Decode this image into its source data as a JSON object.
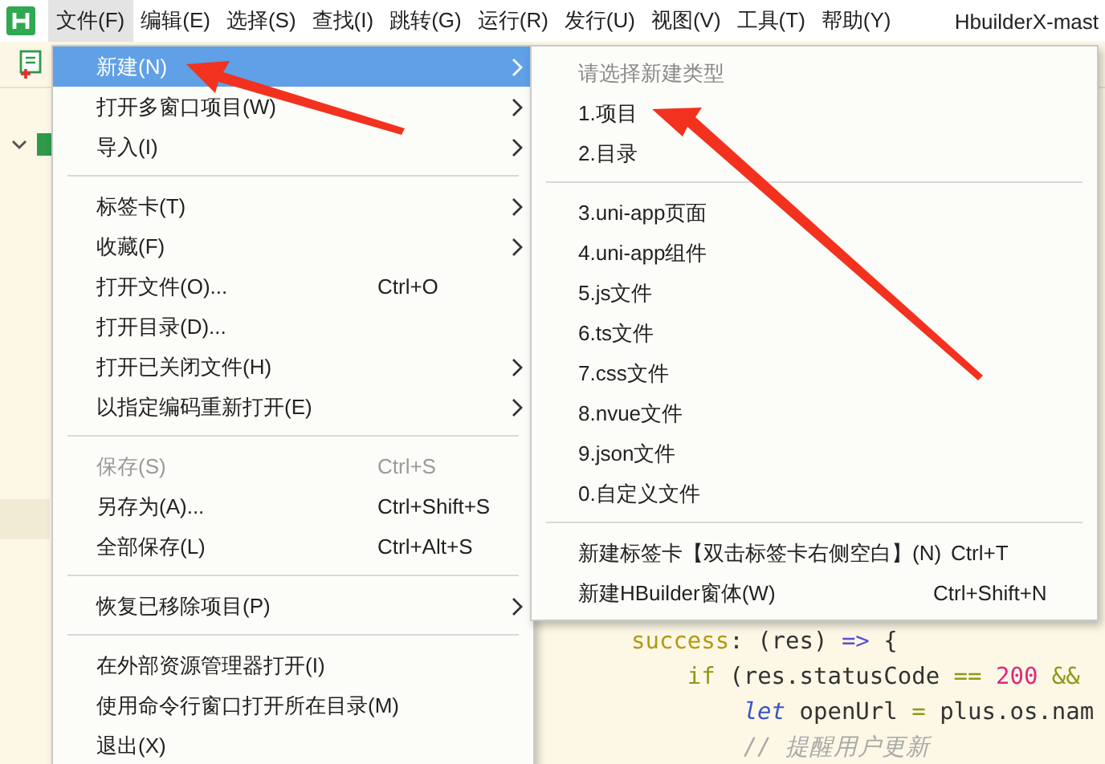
{
  "menu_bar": [
    {
      "label": "文件(F)",
      "selected": true
    },
    {
      "label": "编辑(E)",
      "selected": false
    },
    {
      "label": "选择(S)",
      "selected": false
    },
    {
      "label": "查找(I)",
      "selected": false
    },
    {
      "label": "跳转(G)",
      "selected": false
    },
    {
      "label": "运行(R)",
      "selected": false
    },
    {
      "label": "发行(U)",
      "selected": false
    },
    {
      "label": "视图(V)",
      "selected": false
    },
    {
      "label": "工具(T)",
      "selected": false
    },
    {
      "label": "帮助(Y)",
      "selected": false
    }
  ],
  "window_title": "HbuilderX-mast",
  "project_tree": {
    "expanded": true
  },
  "file_menu": {
    "items": [
      {
        "kind": "item",
        "label": "新建(N)",
        "submenu": true,
        "selected": true,
        "disabled": false
      },
      {
        "kind": "item",
        "label": "打开多窗口项目(W)",
        "submenu": true,
        "selected": false,
        "disabled": false
      },
      {
        "kind": "item",
        "label": "导入(I)",
        "submenu": true,
        "selected": false,
        "disabled": false
      },
      {
        "kind": "separator"
      },
      {
        "kind": "item",
        "label": "标签卡(T)",
        "submenu": true,
        "selected": false,
        "disabled": false
      },
      {
        "kind": "item",
        "label": "收藏(F)",
        "submenu": true,
        "selected": false,
        "disabled": false
      },
      {
        "kind": "item",
        "label": "打开文件(O)...",
        "shortcut": "Ctrl+O",
        "submenu": false,
        "selected": false,
        "disabled": false
      },
      {
        "kind": "item",
        "label": "打开目录(D)...",
        "submenu": false,
        "selected": false,
        "disabled": false
      },
      {
        "kind": "item",
        "label": "打开已关闭文件(H)",
        "submenu": true,
        "selected": false,
        "disabled": false
      },
      {
        "kind": "item",
        "label": "以指定编码重新打开(E)",
        "submenu": true,
        "selected": false,
        "disabled": false
      },
      {
        "kind": "separator"
      },
      {
        "kind": "item",
        "label": "保存(S)",
        "shortcut": "Ctrl+S",
        "submenu": false,
        "selected": false,
        "disabled": true
      },
      {
        "kind": "item",
        "label": "另存为(A)...",
        "shortcut": "Ctrl+Shift+S",
        "submenu": false,
        "selected": false,
        "disabled": false
      },
      {
        "kind": "item",
        "label": "全部保存(L)",
        "shortcut": "Ctrl+Alt+S",
        "submenu": false,
        "selected": false,
        "disabled": false
      },
      {
        "kind": "separator"
      },
      {
        "kind": "item",
        "label": "恢复已移除项目(P)",
        "submenu": true,
        "selected": false,
        "disabled": false
      },
      {
        "kind": "separator"
      },
      {
        "kind": "item",
        "label": "在外部资源管理器打开(I)",
        "submenu": false,
        "selected": false,
        "disabled": false
      },
      {
        "kind": "item",
        "label": "使用命令行窗口打开所在目录(M)",
        "submenu": false,
        "selected": false,
        "disabled": false
      },
      {
        "kind": "item",
        "label": "退出(X)",
        "submenu": false,
        "selected": false,
        "disabled": false
      }
    ]
  },
  "new_submenu": {
    "items": [
      {
        "kind": "header",
        "label": "请选择新建类型"
      },
      {
        "kind": "item",
        "label": "1.项目",
        "submenu": false,
        "selected": false,
        "disabled": false
      },
      {
        "kind": "item",
        "label": "2.目录",
        "submenu": false,
        "selected": false,
        "disabled": false
      },
      {
        "kind": "separator"
      },
      {
        "kind": "item",
        "label": "3.uni-app页面",
        "submenu": false,
        "selected": false,
        "disabled": false
      },
      {
        "kind": "item",
        "label": "4.uni-app组件",
        "submenu": false,
        "selected": false,
        "disabled": false
      },
      {
        "kind": "item",
        "label": "5.js文件",
        "submenu": false,
        "selected": false,
        "disabled": false
      },
      {
        "kind": "item",
        "label": "6.ts文件",
        "submenu": false,
        "selected": false,
        "disabled": false
      },
      {
        "kind": "item",
        "label": "7.css文件",
        "submenu": false,
        "selected": false,
        "disabled": false
      },
      {
        "kind": "item",
        "label": "8.nvue文件",
        "submenu": false,
        "selected": false,
        "disabled": false
      },
      {
        "kind": "item",
        "label": "9.json文件",
        "submenu": false,
        "selected": false,
        "disabled": false
      },
      {
        "kind": "item",
        "label": "0.自定义文件",
        "submenu": false,
        "selected": false,
        "disabled": false
      },
      {
        "kind": "separator"
      },
      {
        "kind": "item",
        "label": "新建标签卡【双击标签卡右侧空白】(N)",
        "shortcut": "Ctrl+T",
        "submenu": false,
        "selected": false,
        "disabled": false
      },
      {
        "kind": "item",
        "label": "新建HBuilder窗体(W)",
        "shortcut": "Ctrl+Shift+N",
        "submenu": false,
        "selected": false,
        "disabled": false
      }
    ]
  },
  "code_lines": [
    {
      "tokens": [
        {
          "kind": "property",
          "text": "success"
        },
        {
          "kind": "plain",
          "text": ": (res) "
        },
        {
          "kind": "operator",
          "text": "=>"
        },
        {
          "kind": "plain",
          "text": " {"
        }
      ],
      "children": [
        {
          "tokens": [
            {
              "kind": "control",
              "text": "if"
            },
            {
              "kind": "plain",
              "text": " (res.statusCode "
            },
            {
              "kind": "control",
              "text": "== "
            },
            {
              "kind": "number",
              "text": "200 "
            },
            {
              "kind": "control",
              "text": "&&"
            }
          ],
          "children": [
            {
              "tokens": [
                {
                  "kind": "keyword",
                  "text": "let"
                },
                {
                  "kind": "plain",
                  "text": " openUrl "
                },
                {
                  "kind": "control",
                  "text": "="
                },
                {
                  "kind": "plain",
                  "text": " plus.os.nam"
                }
              ]
            },
            {
              "tokens": [
                {
                  "kind": "comment",
                  "text": "// 提醒用户更新"
                }
              ]
            }
          ]
        }
      ]
    }
  ]
}
